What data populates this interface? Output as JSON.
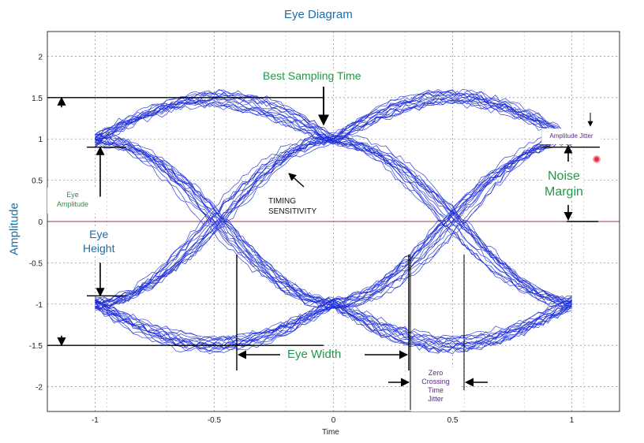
{
  "chart_data": {
    "type": "line",
    "title": "Eye Diagram",
    "xlabel": "Time",
    "ylabel": "Amplitude",
    "xlim": [
      -1.2,
      1.2
    ],
    "ylim": [
      -2.3,
      2.3
    ],
    "x_ticks": [
      -1,
      -0.5,
      0,
      0.5,
      1
    ],
    "x_tick_labels": [
      "-1",
      "-0.5",
      "0",
      "0.5",
      "1"
    ],
    "y_ticks": [
      2,
      1.5,
      1,
      0.5,
      0,
      -0.5,
      -1,
      -1.5,
      -2
    ],
    "y_tick_labels": [
      "2",
      "1.5",
      "1",
      "0.5",
      "0",
      "-0.5",
      "-1",
      "-1.5",
      "-2"
    ],
    "grid": true,
    "trace_levels": [
      1,
      -1
    ],
    "trace_peak": 1.5,
    "trace_x_range": [
      -1,
      1
    ],
    "crossings_x": [
      -0.5,
      0.5
    ],
    "annotations": {
      "best_sampling_time": "Best Sampling Time",
      "amplitude_jitter": "Amplitude Jitter",
      "noise_margin": "Noise\nMargin",
      "timing_sensitivity": "TIMING\nSENSITIVITY",
      "eye_amplitude": "Eye\nAmplitude",
      "eye_height": "Eye\nHeight",
      "eye_width": "Eye Width",
      "zero_crossing_time_jitter": "Zero\nCrossing\nTime\nJitter"
    }
  },
  "colors": {
    "trace": "#1f2fd6",
    "title": "#1a6ea8",
    "annotation_green": "#1e9a46",
    "annotation_blue": "#1a6ea8",
    "annotation_purple": "#5b2a86",
    "zero_line": "#a03040",
    "marker": "#e03040"
  }
}
